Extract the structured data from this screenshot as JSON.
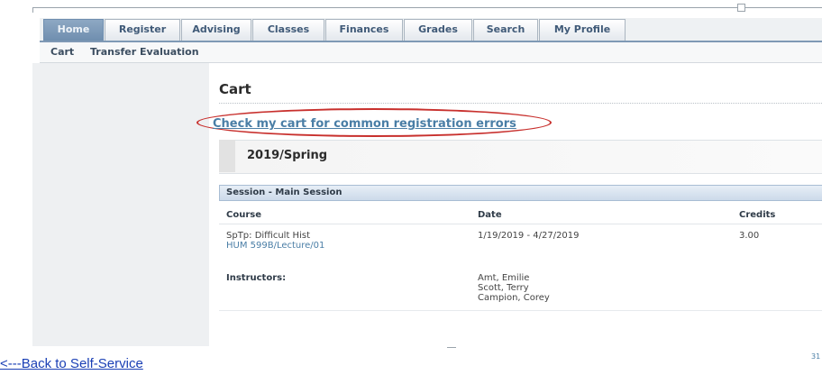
{
  "tabs": [
    {
      "label": "Home",
      "active": true
    },
    {
      "label": "Register",
      "active": false
    },
    {
      "label": "Advising",
      "active": false
    },
    {
      "label": "Classes",
      "active": false
    },
    {
      "label": "Finances",
      "active": false
    },
    {
      "label": "Grades",
      "active": false
    },
    {
      "label": "Search",
      "active": false
    },
    {
      "label": "My Profile",
      "active": false
    }
  ],
  "subnav": [
    "Cart",
    "Transfer Evaluation"
  ],
  "page": {
    "title": "Cart",
    "check_link": "Check my cart for common registration errors"
  },
  "term": "2019/Spring",
  "session": {
    "label": "Session - Main Session",
    "columns": {
      "course": "Course",
      "date": "Date",
      "credits": "Credits"
    },
    "course": {
      "title": "SpTp: Difficult Hist",
      "section": "HUM 599B/Lecture/01",
      "date": "1/19/2019 - 4/27/2019",
      "credits": "3.00",
      "instructors_label": "Instructors:",
      "instructors": [
        "Amt, Emilie",
        "Scott, Terry",
        "Campion, Corey"
      ]
    }
  },
  "footer": {
    "back_link": "<---Back to Self-Service",
    "page_num": "31"
  },
  "colors": {
    "tab_active": "#7a97b8",
    "link": "#4a7ea6",
    "highlight_ellipse": "#c8302d",
    "back_link": "#1a3fb5"
  }
}
